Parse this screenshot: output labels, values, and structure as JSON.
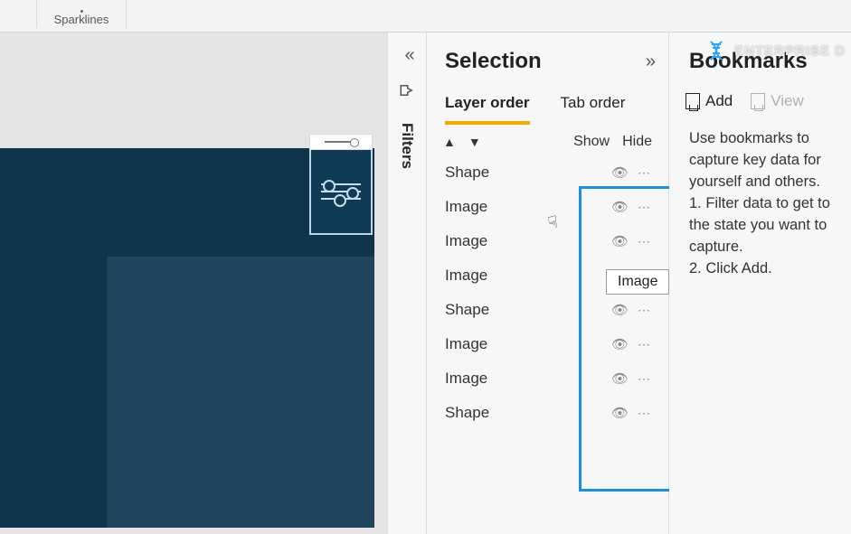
{
  "ribbon": {
    "group_label": "Sparklines"
  },
  "filters": {
    "label": "Filters"
  },
  "selection": {
    "title": "Selection",
    "tabs": {
      "layer_order": "Layer order",
      "tab_order": "Tab order"
    },
    "columns": {
      "show": "Show",
      "hide": "Hide"
    },
    "items": [
      {
        "label": "Shape"
      },
      {
        "label": "Image"
      },
      {
        "label": "Image"
      },
      {
        "label": "Image"
      },
      {
        "label": "Shape"
      },
      {
        "label": "Image"
      },
      {
        "label": "Image"
      },
      {
        "label": "Shape"
      }
    ],
    "tooltip": "Image"
  },
  "bookmarks": {
    "title": "Bookmarks",
    "add_label": "Add",
    "view_label": "View",
    "help_line1": "Use bookmarks to capture key data for yourself and others.",
    "help_line2": "1. Filter data to get to the state you want to capture.",
    "help_line3": "2. Click Add."
  },
  "watermark": {
    "text": "ENTERPRISE D"
  }
}
